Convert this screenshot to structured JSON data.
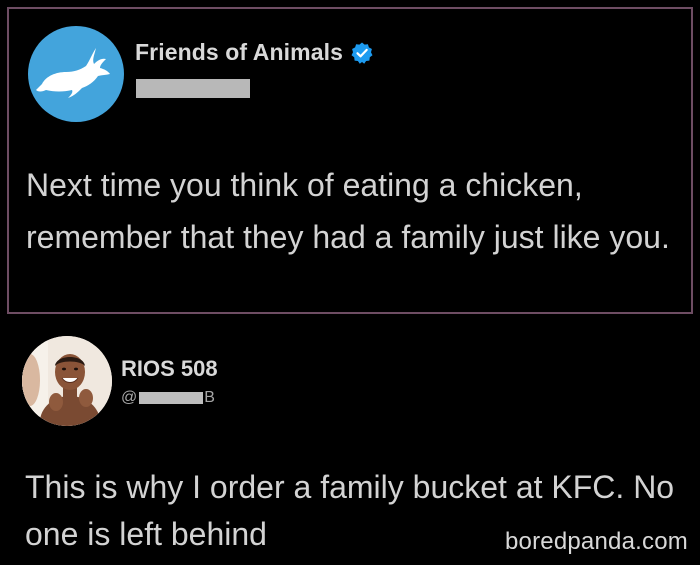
{
  "tweet_original": {
    "display_name": "Friends of Animals",
    "verified": true,
    "avatar_icon": "rabbit-logo-icon",
    "text": "Next time you think of eating a chicken, remember that they had a family  just like you.",
    "colors": {
      "avatar_bg": "#43a4dc",
      "verified_badge": "#1d9bf0",
      "border": "#6e4d63"
    }
  },
  "tweet_reply": {
    "display_name": "RIOS 508",
    "handle_prefix": "@",
    "handle_suffix": "B",
    "avatar_icon": "user-photo-avatar",
    "text": "This is why I order a family bucket at KFC. No one is left behind"
  },
  "watermark": {
    "text": "boredpanda.com"
  }
}
